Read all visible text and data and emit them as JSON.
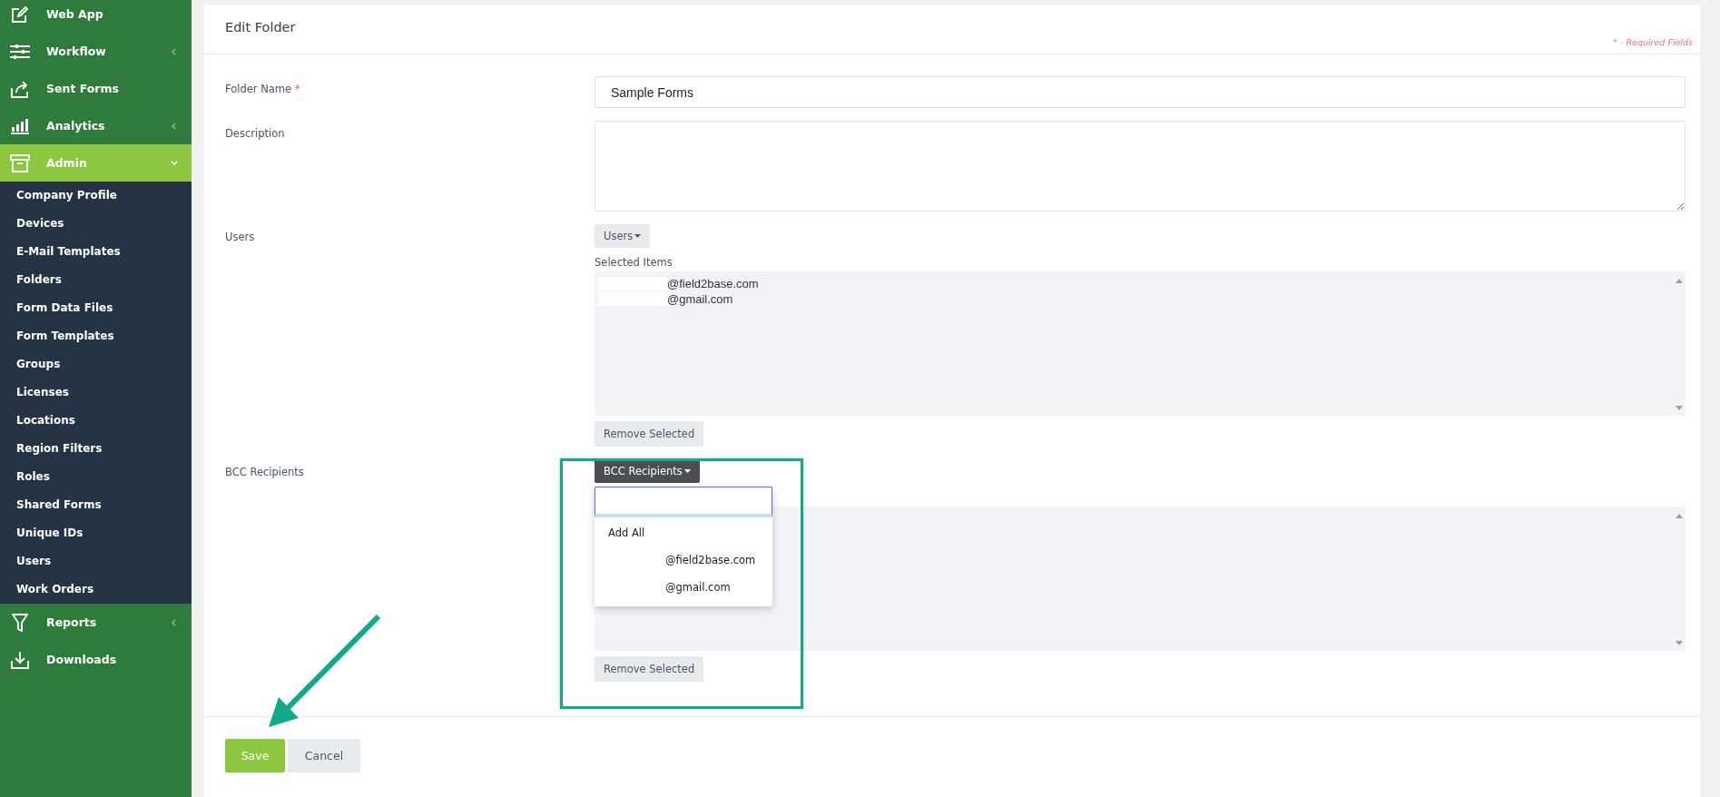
{
  "sidebar": {
    "items": [
      {
        "label": "Web App",
        "kind": "link",
        "selected": false
      },
      {
        "label": "Workflow",
        "kind": "menu",
        "expanded": false,
        "selected": false
      },
      {
        "label": "Sent Forms",
        "kind": "link",
        "selected": false
      },
      {
        "label": "Analytics",
        "kind": "menu",
        "expanded": false,
        "selected": false
      },
      {
        "label": "Admin",
        "kind": "menu",
        "expanded": true,
        "selected": true,
        "children": [
          {
            "label": "Company Profile",
            "selected": false
          },
          {
            "label": "Devices",
            "selected": false
          },
          {
            "label": "E-Mail Templates",
            "selected": false
          },
          {
            "label": "Folders",
            "selected": false
          },
          {
            "label": "Form Data Files",
            "selected": false
          },
          {
            "label": "Form Templates",
            "selected": false
          },
          {
            "label": "Groups",
            "selected": false
          },
          {
            "label": "Licenses",
            "selected": false
          },
          {
            "label": "Locations",
            "selected": false
          },
          {
            "label": "Region Filters",
            "selected": false
          },
          {
            "label": "Roles",
            "selected": false
          },
          {
            "label": "Shared Forms",
            "selected": false
          },
          {
            "label": "Unique IDs",
            "selected": false
          },
          {
            "label": "Users",
            "selected": false
          },
          {
            "label": "Work Orders",
            "selected": false
          }
        ]
      },
      {
        "label": "Reports",
        "kind": "menu",
        "expanded": false,
        "selected": false
      },
      {
        "label": "Downloads",
        "kind": "link",
        "selected": false
      }
    ]
  },
  "page": {
    "title": "Edit Folder",
    "required_note": "* - Required Fields"
  },
  "form": {
    "fields": [
      {
        "kind": "text",
        "label": "Folder Name",
        "required_mark": "*",
        "value": "Sample Forms"
      },
      {
        "kind": "textarea",
        "label": "Description"
      },
      {
        "kind": "picker",
        "label": "Users",
        "button": "Users",
        "open": false,
        "selected_caption": "Selected Items",
        "items": [
          "@field2base.com",
          "@gmail.com"
        ],
        "remove_button": "Remove Selected"
      },
      {
        "kind": "picker",
        "label": "BCC Recipients",
        "button": "BCC Recipients",
        "open": true,
        "menu": {
          "add_all": "Add All",
          "options": [
            "@field2base.com",
            "@gmail.com"
          ]
        },
        "remove_button": "Remove Selected"
      }
    ]
  },
  "actions": [
    {
      "label": "Save",
      "kind": "primary"
    },
    {
      "label": "Cancel",
      "kind": "secondary"
    }
  ]
}
